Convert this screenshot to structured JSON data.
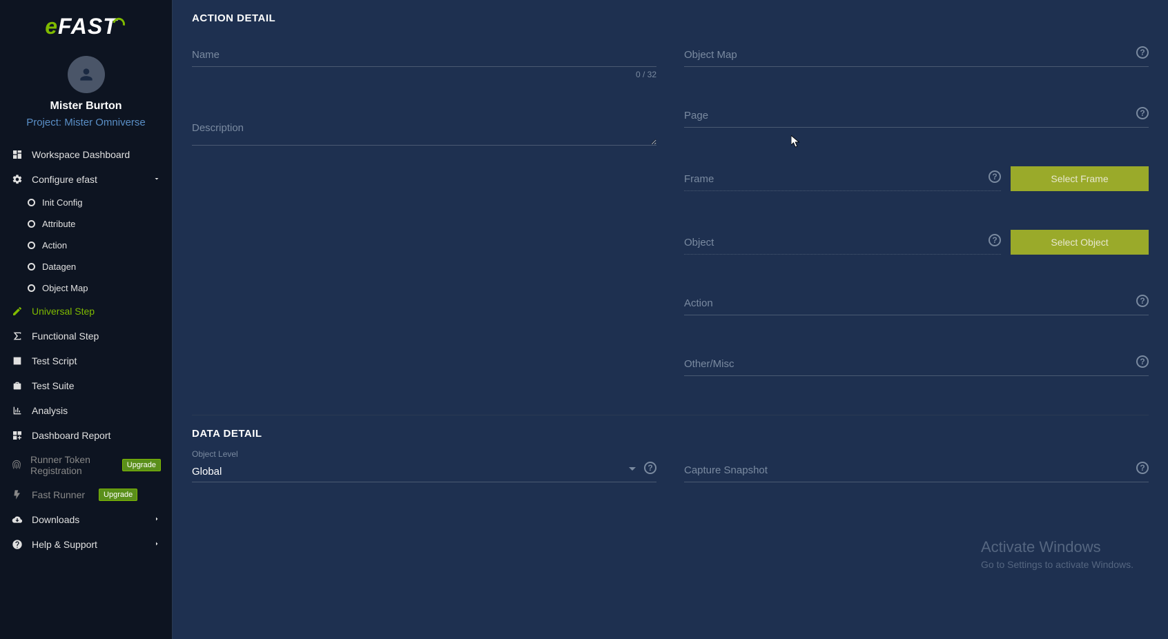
{
  "logo": {
    "e": "e",
    "fast": "FAST"
  },
  "user": {
    "name": "Mister Burton",
    "project": "Project: Mister Omniverse"
  },
  "sidebar": {
    "workspace_dashboard": "Workspace Dashboard",
    "configure_efast": "Configure efast",
    "sub": {
      "init_config": "Init Config",
      "attribute": "Attribute",
      "action": "Action",
      "datagen": "Datagen",
      "object_map": "Object Map"
    },
    "universal_step": "Universal Step",
    "functional_step": "Functional Step",
    "test_script": "Test Script",
    "test_suite": "Test Suite",
    "analysis": "Analysis",
    "dashboard_report": "Dashboard Report",
    "runner_token": "Runner Token Registration",
    "fast_runner": "Fast Runner",
    "downloads": "Downloads",
    "help_support": "Help & Support",
    "upgrade": "Upgrade"
  },
  "main": {
    "action_detail": "ACTION DETAIL",
    "data_detail": "DATA DETAIL",
    "fields": {
      "name": "Name",
      "name_count": "0 / 32",
      "description": "Description",
      "object_map": "Object Map",
      "page": "Page",
      "frame": "Frame",
      "object": "Object",
      "action": "Action",
      "other_misc": "Other/Misc",
      "object_level": "Object Level",
      "object_level_value": "Global",
      "capture_snapshot": "Capture Snapshot"
    },
    "buttons": {
      "select_frame": "Select Frame",
      "select_object": "Select Object"
    }
  },
  "watermark": {
    "title": "Activate Windows",
    "sub": "Go to Settings to activate Windows."
  }
}
